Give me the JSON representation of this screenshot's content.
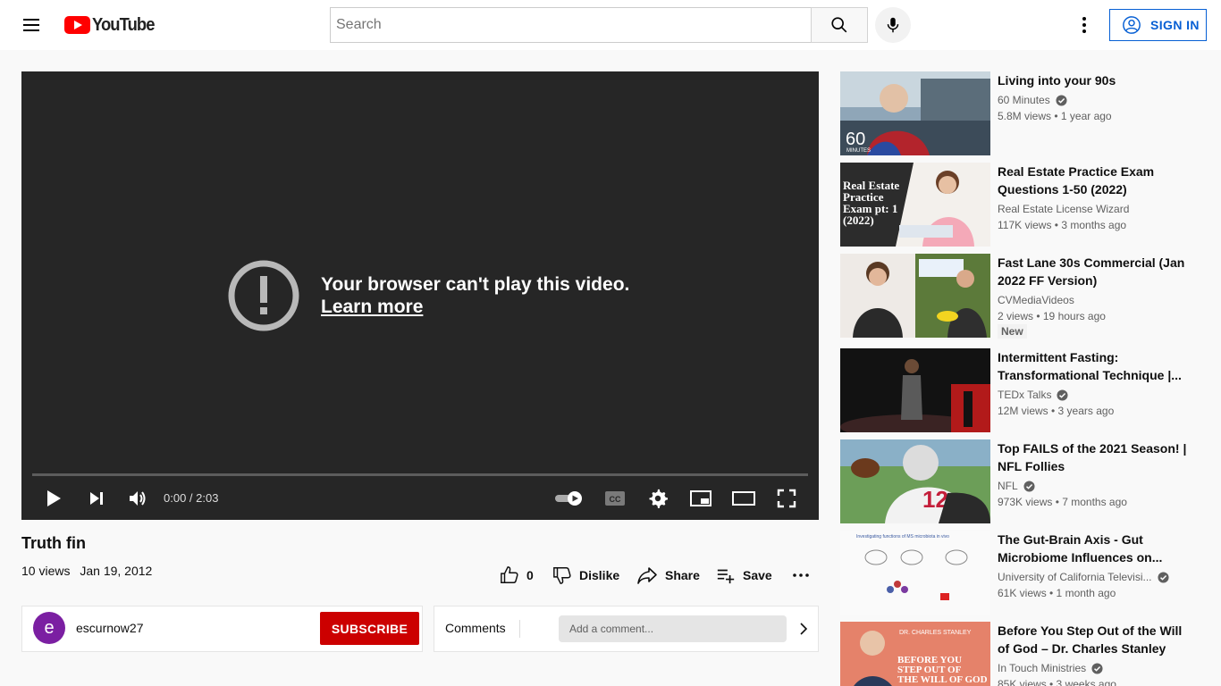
{
  "header": {
    "logo_text": "YouTube",
    "search_placeholder": "Search",
    "signin_label": "SIGN IN"
  },
  "player": {
    "error_message": "Your browser can't play this video.",
    "learn_more": "Learn more",
    "time": "0:00 / 2:03"
  },
  "video": {
    "title": "Truth fin",
    "views": "10 views",
    "date": "Jan 19, 2012",
    "like_count": "0",
    "dislike_label": "Dislike",
    "share_label": "Share",
    "save_label": "Save"
  },
  "channel": {
    "avatar_letter": "e",
    "name": "escurnow27",
    "subscribe_label": "SUBSCRIBE"
  },
  "comments": {
    "label": "Comments",
    "placeholder": "Add a comment..."
  },
  "recommendations": [
    {
      "title": "Living into your 90s",
      "channel": "60 Minutes",
      "verified": true,
      "stats": "5.8M views • 1 year ago"
    },
    {
      "title": "Real Estate Practice Exam Questions 1-50 (2022)",
      "channel": "Real Estate License Wizard",
      "verified": false,
      "stats": "117K views • 3 months ago"
    },
    {
      "title": "Fast Lane 30s Commercial (Jan 2022 FF Version)",
      "channel": "CVMediaVideos",
      "verified": false,
      "stats": "2 views • 19 hours ago",
      "badge": "New"
    },
    {
      "title": "Intermittent Fasting: Transformational Technique |...",
      "channel": "TEDx Talks",
      "verified": true,
      "stats": "12M views • 3 years ago"
    },
    {
      "title": "Top FAILS of the 2021 Season! | NFL Follies",
      "channel": "NFL",
      "verified": true,
      "stats": "973K views • 7 months ago"
    },
    {
      "title": "The Gut-Brain Axis - Gut Microbiome Influences on...",
      "channel": "University of California Televisi...",
      "verified": true,
      "stats": "61K views • 1 month ago"
    },
    {
      "title": "Before You Step Out of the Will of God – Dr. Charles Stanley",
      "channel": "In Touch Ministries",
      "verified": true,
      "stats": "85K views • 3 weeks ago"
    }
  ],
  "thumbnails": {
    "t0_overlay": "60",
    "t0_overlay_sub": "MINUTES",
    "t1_text": [
      "Real Estate",
      "Practice",
      "Exam pt: 1",
      "(2022)"
    ],
    "t4_jersey": "12",
    "t5_title": "Investigating functions of MS microbiota in vivo",
    "t6_banner": "DR. CHARLES STANLEY",
    "t6_text": [
      "BEFORE YOU",
      "STEP OUT OF",
      "THE WILL OF GOD"
    ]
  }
}
